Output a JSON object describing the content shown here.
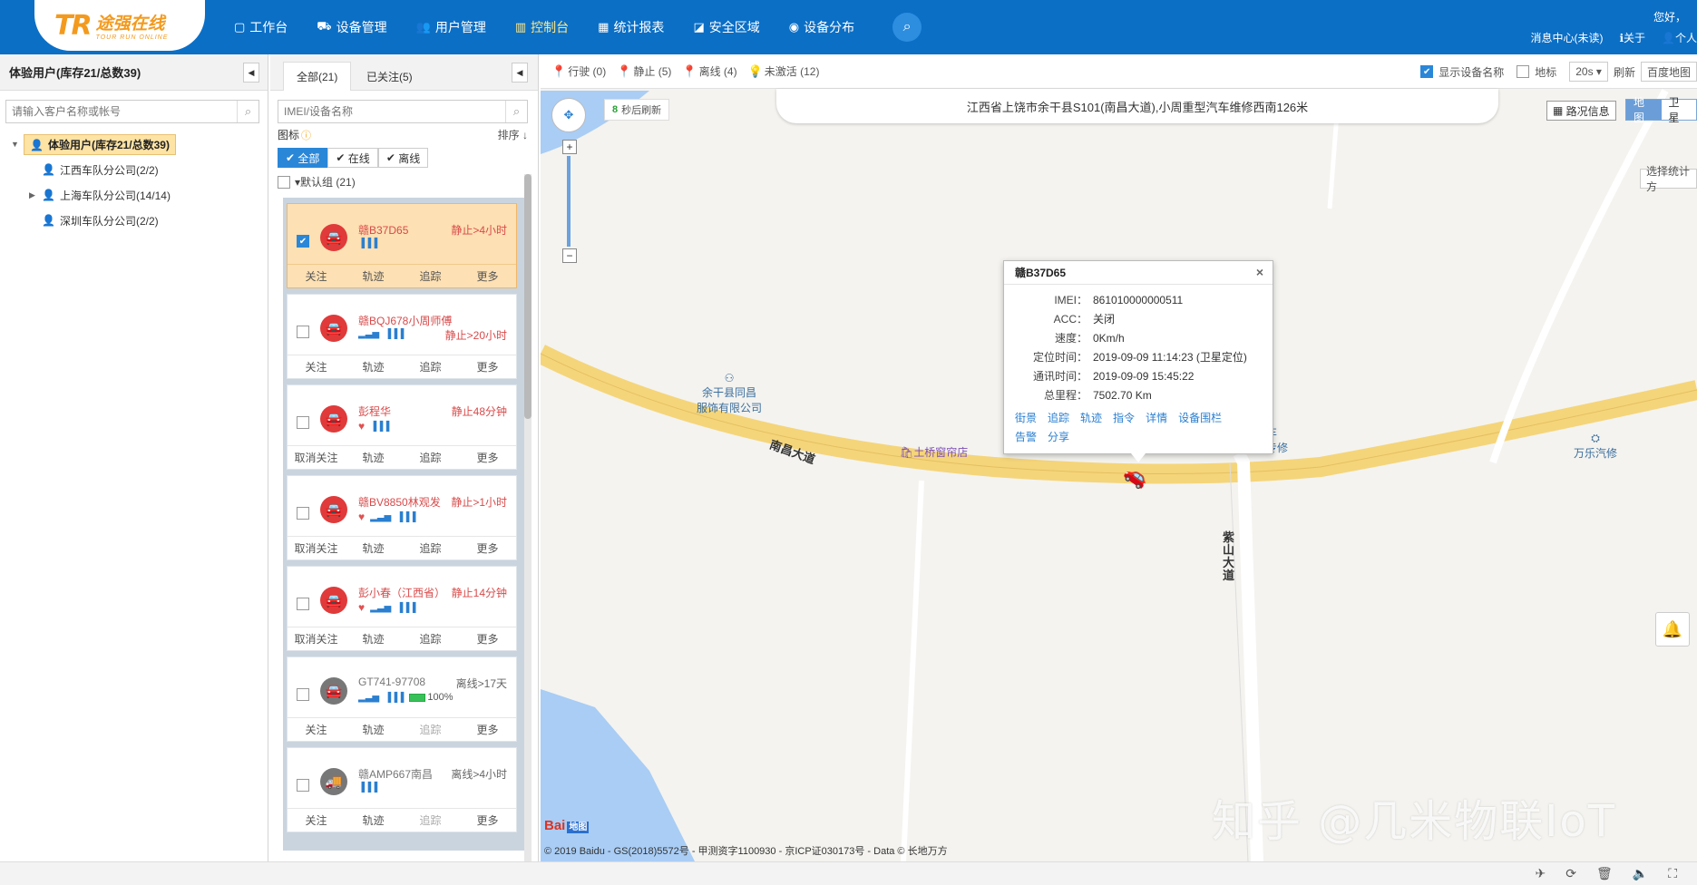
{
  "brand": {
    "mark": "TR",
    "name": "途强在线",
    "tagline": "TOUR RUN ONLINE"
  },
  "nav": [
    {
      "icon": "▢",
      "label": "工作台"
    },
    {
      "icon": "⛟",
      "label": "设备管理"
    },
    {
      "icon": "👥",
      "label": "用户管理"
    },
    {
      "icon": "▥",
      "label": "控制台"
    },
    {
      "icon": "▦",
      "label": "统计报表"
    },
    {
      "icon": "◪",
      "label": "安全区域"
    },
    {
      "icon": "◉",
      "label": "设备分布"
    }
  ],
  "header": {
    "greeting": "您好，",
    "messages": "消息中心(未读)",
    "about": "ℹ关于",
    "user": "👤个人"
  },
  "customer_panel": {
    "title": "体验用户(库存21/总数39)",
    "search_placeholder": "请输入客户名称或帐号",
    "tree": [
      {
        "label": "体验用户(库存21/总数39)"
      },
      {
        "label": "江西车队分公司(2/2)"
      },
      {
        "label": "上海车队分公司(14/14)"
      },
      {
        "label": "深圳车队分公司(2/2)"
      }
    ]
  },
  "device_panel": {
    "tabs": [
      "全部(21)",
      "已关注(5)"
    ],
    "search_placeholder": "IMEI/设备名称",
    "icon_label": "图标",
    "sort_label": "排序 ↓",
    "chips": [
      "全部",
      "在线",
      "离线"
    ],
    "group": "默认组 (21)",
    "devices": [
      {
        "plate": "赣B37D65",
        "status": "静止>4小时",
        "follow": "关注",
        "selected": true
      },
      {
        "plate": "赣BQJ678小周师傅",
        "status": "静止>20小时",
        "follow": "关注"
      },
      {
        "plate": "彭程华",
        "status": "静止48分钟",
        "follow": "取消关注"
      },
      {
        "plate": "赣BV8850林观发",
        "status": "静止>1小时",
        "follow": "取消关注"
      },
      {
        "plate": "彭小春（江西省）",
        "status": "静止14分钟",
        "follow": "取消关注"
      },
      {
        "plate": "GT741-97708",
        "status": "离线>17天",
        "follow": "关注",
        "battery": "100%"
      },
      {
        "plate": "赣AMP667南昌",
        "status": "离线>4小时",
        "follow": "关注"
      }
    ],
    "actions": [
      "轨迹",
      "追踪",
      "更多"
    ]
  },
  "map_bar": {
    "legend": [
      {
        "label": "行驶 (0)",
        "color": "#2aa036"
      },
      {
        "label": "静止 (5)",
        "color": "#e03a3a"
      },
      {
        "label": "离线 (4)",
        "color": "#555555"
      },
      {
        "label": "未激活 (12)",
        "color": "#777777"
      }
    ],
    "show_name": "显示设备名称",
    "landmark": "地标",
    "interval": "20s ▾",
    "refresh": "刷新",
    "baidu_map": "百度地图"
  },
  "map": {
    "address": "江西省上饶市余干县S101(南昌大道),小周重型汽车维修西南126米",
    "refresh_seconds": "8",
    "refresh_text": "秒后刷新",
    "traffic": "路况信息",
    "map_types": [
      "地图",
      "卫星"
    ],
    "stat_button": "选择统计方",
    "pois": [
      {
        "label": "余干县同昌\n服饰有限公司"
      },
      {
        "label": "土桥窗帘店"
      },
      {
        "label": "汽车\n电器专修"
      },
      {
        "label": "万乐汽修"
      }
    ],
    "roads": [
      "南昌大道",
      "紫\n山\n大\n道"
    ],
    "copyright": "© 2019 Baidu - GS(2018)5572号 - 甲测资字1100930 - 京ICP证030173号 - Data © 长地万方",
    "baidu_logo": "Bai",
    "baidu_logo_tag": "地图",
    "watermark": "知乎 @几米物联IoT"
  },
  "popup": {
    "title": "赣B37D65",
    "close": "×",
    "rows": [
      {
        "label": "IMEI：",
        "value": "861010000000511"
      },
      {
        "label": "ACC：",
        "value": "关闭"
      },
      {
        "label": "速度：",
        "value": "0Km/h"
      },
      {
        "label": "定位时间：",
        "value": "2019-09-09 11:14:23 (卫星定位)"
      },
      {
        "label": "通讯时间：",
        "value": "2019-09-09 15:45:22"
      },
      {
        "label": "总里程：",
        "value": "7502.70 Km"
      }
    ],
    "links": [
      "街景",
      "追踪",
      "轨迹",
      "指令",
      "详情",
      "设备围栏",
      "告警",
      "分享"
    ]
  }
}
